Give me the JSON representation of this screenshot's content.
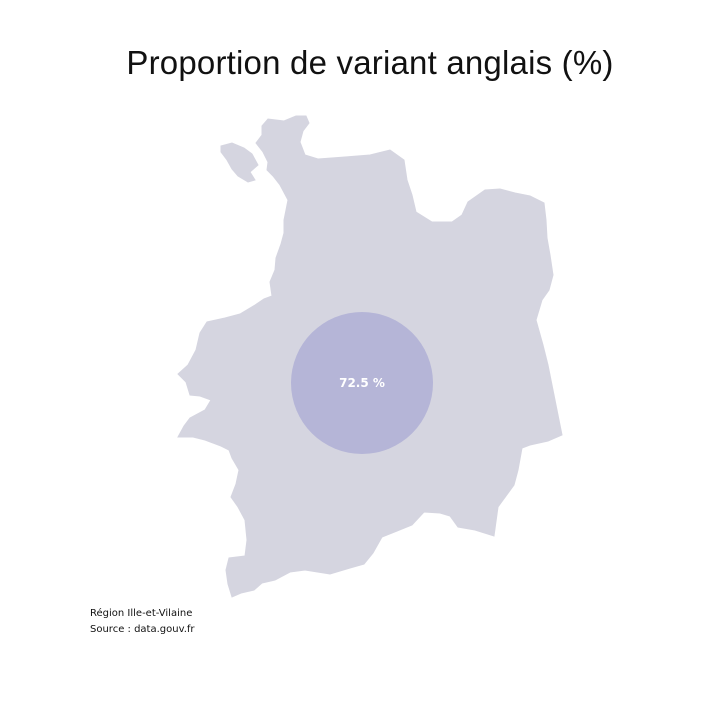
{
  "title": "Proportion de variant anglais (%)",
  "map": {
    "region": "Ille-et-Vilaine",
    "fill_color": "#d5d5e0",
    "bubble": {
      "value": 72.5,
      "label": "72.5 %",
      "color": "#a9a9d4"
    }
  },
  "notes": {
    "line1": "Région Ille-et-Vilaine",
    "line2": "Source : data.gouv.fr"
  }
}
